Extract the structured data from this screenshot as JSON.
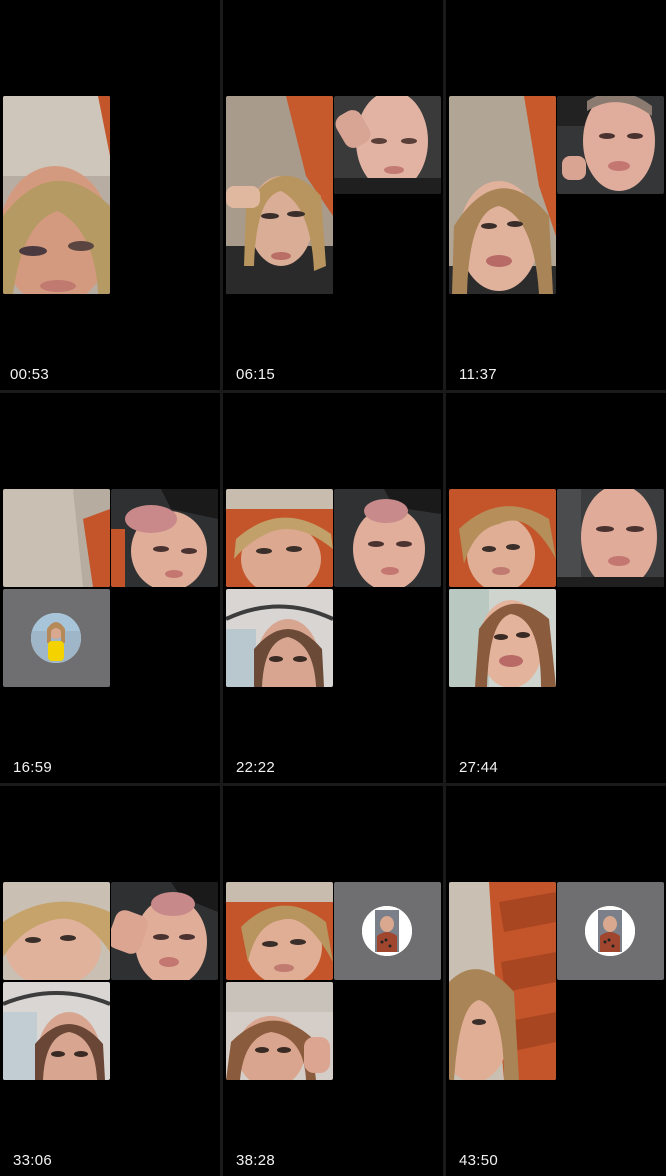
{
  "recordings": [
    {
      "duration": "00:53"
    },
    {
      "duration": "06:15"
    },
    {
      "duration": "11:37"
    },
    {
      "duration": "16:59"
    },
    {
      "duration": "22:22"
    },
    {
      "duration": "27:44"
    },
    {
      "duration": "33:06"
    },
    {
      "duration": "38:28"
    },
    {
      "duration": "43:50"
    }
  ]
}
